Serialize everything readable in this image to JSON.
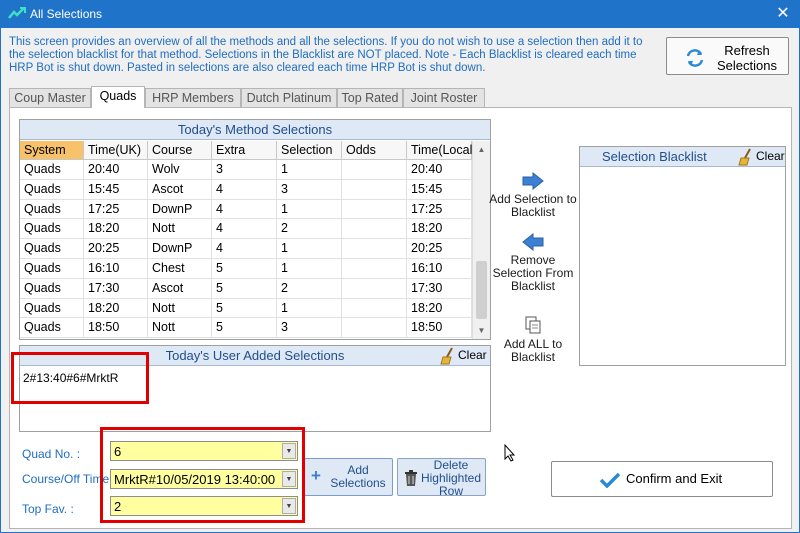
{
  "window": {
    "title": "All Selections",
    "close_glyph": "✕"
  },
  "intro_text": "This screen provides an overview of all the methods and all the selections. If you do not wish to use a selection then add it to the selection blacklist for that method. Selections in the Blacklist are NOT placed. Note - Each Blacklist is cleared each time HRP Bot is shut down. Pasted in selections are also cleared each time HRP Bot is shut down.",
  "refresh_button": {
    "label": "Refresh Selections",
    "icon": "refresh-icon"
  },
  "tabs": [
    {
      "label": "Coup Master"
    },
    {
      "label": "Quads"
    },
    {
      "label": "HRP Members"
    },
    {
      "label": "Dutch Platinum"
    },
    {
      "label": "Top Rated"
    },
    {
      "label": "Joint Roster"
    }
  ],
  "method_selections": {
    "title": "Today's Method Selections",
    "columns": [
      "System",
      "Time(UK)",
      "Course",
      "Extra",
      "Selection",
      "Odds",
      "Time(Local"
    ],
    "rows": [
      [
        "Quads",
        "20:40",
        "Wolv",
        "3",
        "1",
        "",
        "20:40"
      ],
      [
        "Quads",
        "15:45",
        "Ascot",
        "4",
        "3",
        "",
        "15:45"
      ],
      [
        "Quads",
        "17:25",
        "DownP",
        "4",
        "1",
        "",
        "17:25"
      ],
      [
        "Quads",
        "18:20",
        "Nott",
        "4",
        "2",
        "",
        "18:20"
      ],
      [
        "Quads",
        "20:25",
        "DownP",
        "4",
        "1",
        "",
        "20:25"
      ],
      [
        "Quads",
        "16:10",
        "Chest",
        "5",
        "1",
        "",
        "16:10"
      ],
      [
        "Quads",
        "17:30",
        "Ascot",
        "5",
        "2",
        "",
        "17:30"
      ],
      [
        "Quads",
        "18:20",
        "Nott",
        "5",
        "1",
        "",
        "18:20"
      ],
      [
        "Quads",
        "18:50",
        "Nott",
        "5",
        "3",
        "",
        "18:50"
      ]
    ]
  },
  "side_actions": {
    "add": "Add Selection to Blacklist",
    "remove": "Remove Selection From Blacklist",
    "add_all": "Add ALL to Blacklist"
  },
  "blacklist": {
    "title": "Selection Blacklist",
    "clear_label": "Clear"
  },
  "user_added": {
    "title": "Today's User Added Selections",
    "clear_label": "Clear",
    "entries": [
      "2#13:40#6#MrktR"
    ]
  },
  "form": {
    "quad_label": "Quad No. :",
    "quad_value": "6",
    "course_label": "Course/Off Time :",
    "course_value": "MrktR#10/05/2019 13:40:00",
    "topfav_label": "Top Fav. :",
    "topfav_value": "2"
  },
  "buttons": {
    "add_selections": "Add Selections",
    "delete_row": "Delete Highlighted Row",
    "confirm_exit": "Confirm and Exit"
  },
  "colors": {
    "titlebar": "#1f73c9",
    "accent_text": "#1f6dc1",
    "header_bg": "#dfe9f6",
    "selected_column": "#f7c26a",
    "field_highlight": "#ffffa0",
    "annotation_red": "#e00000"
  }
}
